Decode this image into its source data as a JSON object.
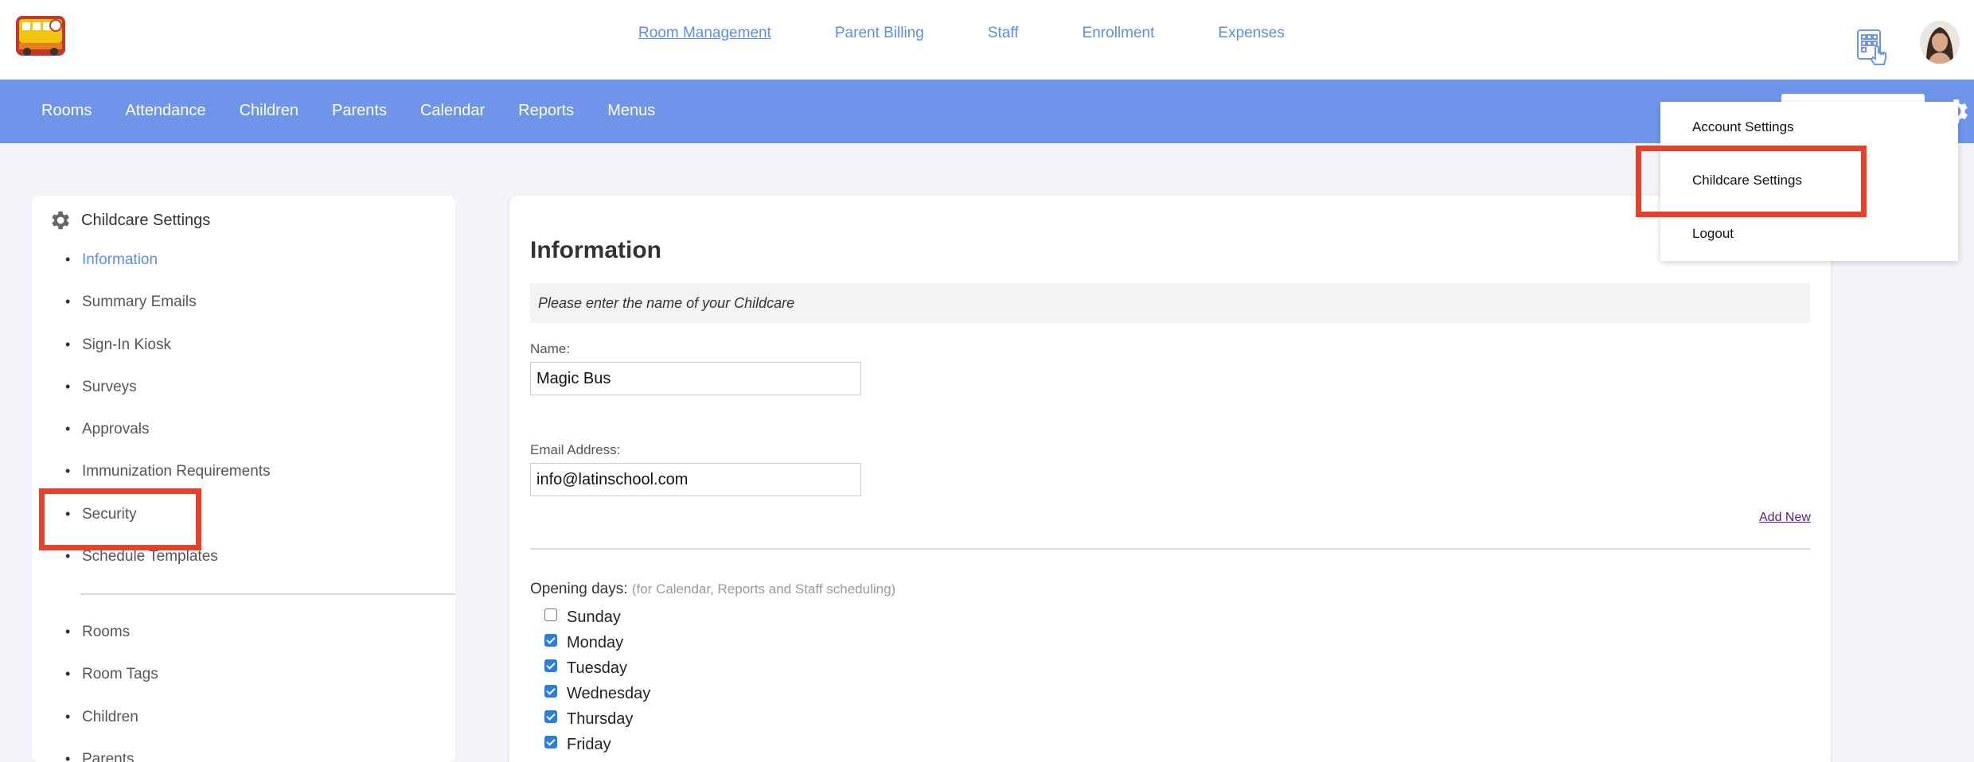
{
  "top_nav": {
    "items": [
      "Room Management",
      "Parent Billing",
      "Staff",
      "Enrollment",
      "Expenses"
    ]
  },
  "sub_nav": {
    "items": [
      "Rooms",
      "Attendance",
      "Children",
      "Parents",
      "Calendar",
      "Reports",
      "Menus"
    ]
  },
  "sidebar": {
    "title": "Childcare Settings",
    "items": [
      "Information",
      "Summary Emails",
      "Sign-In Kiosk",
      "Surveys",
      "Approvals",
      "Immunization Requirements",
      "Security",
      "Schedule Templates"
    ],
    "items2": [
      "Rooms",
      "Room Tags",
      "Children",
      "Parents"
    ]
  },
  "main": {
    "title": "Information",
    "hint": "Please enter the name of your Childcare",
    "name_label": "Name:",
    "name_value": "Magic Bus",
    "email_label": "Email Address:",
    "email_value": "info@latinschool.com",
    "add_new": "Add New",
    "opening_label": "Opening days:",
    "opening_note": "(for Calendar, Reports and Staff scheduling)",
    "days": [
      {
        "label": "Sunday",
        "checked": false
      },
      {
        "label": "Monday",
        "checked": true
      },
      {
        "label": "Tuesday",
        "checked": true
      },
      {
        "label": "Wednesday",
        "checked": true
      },
      {
        "label": "Thursday",
        "checked": true
      },
      {
        "label": "Friday",
        "checked": true
      }
    ]
  },
  "dropdown": {
    "items": [
      "Account Settings",
      "Childcare Settings",
      "Logout"
    ]
  },
  "colors": {
    "accent": "#6f95ea",
    "link": "#5b8ee6",
    "highlight": "#e8402b"
  }
}
